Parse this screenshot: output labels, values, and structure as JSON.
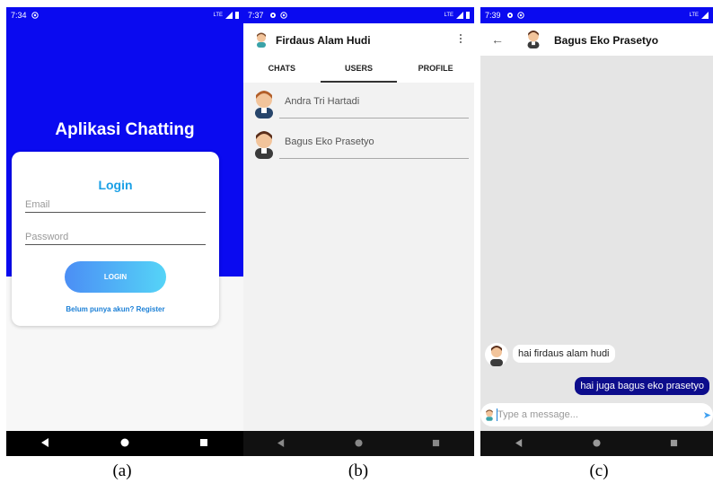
{
  "panel_a": {
    "status_time": "7:34",
    "status_net": "LTE",
    "app_title": "Aplikasi Chatting",
    "login_title": "Login",
    "email_placeholder": "Email",
    "password_placeholder": "Password",
    "login_button": "LOGIN",
    "register_link": "Belum punya akun? Register",
    "caption": "(a)"
  },
  "panel_b": {
    "status_time": "7:37",
    "status_net": "LTE",
    "header_name": "Firdaus Alam Hudi",
    "tabs": [
      "CHATS",
      "USERS",
      "PROFILE"
    ],
    "active_tab": "USERS",
    "users": [
      "Andra Tri Hartadi",
      "Bagus Eko Prasetyo"
    ],
    "caption": "(b)"
  },
  "panel_c": {
    "status_time": "7:39",
    "status_net": "LTE",
    "header_name": "Bagus Eko Prasetyo",
    "incoming_message": "hai firdaus alam hudi",
    "outgoing_message": "hai juga bagus eko prasetyo",
    "input_placeholder": "Type a message...",
    "caption": "(c)"
  },
  "colors": {
    "primary_blue": "#0a0af0",
    "accent": "#1aa0e6",
    "outgoing_bubble": "#0d0d8c"
  },
  "icons": [
    "gear-icon",
    "at-icon",
    "signal-icon",
    "battery-icon",
    "back-triangle-icon",
    "home-circle-icon",
    "recents-square-icon",
    "overflow-menu-icon",
    "arrow-back-icon",
    "send-icon",
    "avatar-icon"
  ]
}
